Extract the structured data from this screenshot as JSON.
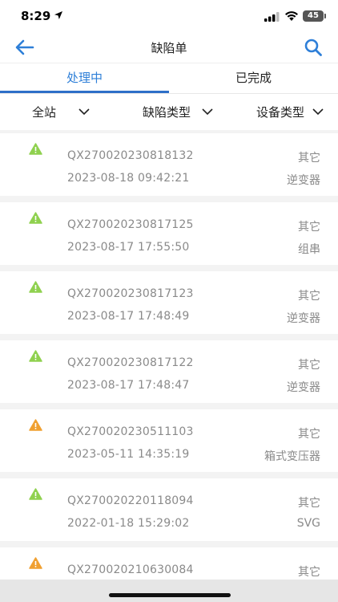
{
  "status_bar": {
    "time": "8:29",
    "battery": "45"
  },
  "nav": {
    "title": "缺陷单"
  },
  "tabs": [
    {
      "label": "处理中",
      "active": true
    },
    {
      "label": "已完成",
      "active": false
    }
  ],
  "filters": [
    {
      "label": "全站"
    },
    {
      "label": "缺陷类型"
    },
    {
      "label": "设备类型"
    }
  ],
  "colors": {
    "accent": "#2e7fd8",
    "warn_green": "#8fd14f",
    "warn_orange": "#f0a030"
  },
  "items": [
    {
      "code": "QX270020230818132",
      "time": "2023-08-18 09:42:21",
      "type": "其它",
      "device": "逆变器",
      "level": "green"
    },
    {
      "code": "QX270020230817125",
      "time": "2023-08-17 17:55:50",
      "type": "其它",
      "device": "组串",
      "level": "green"
    },
    {
      "code": "QX270020230817123",
      "time": "2023-08-17 17:48:49",
      "type": "其它",
      "device": "逆变器",
      "level": "green"
    },
    {
      "code": "QX270020230817122",
      "time": "2023-08-17 17:48:47",
      "type": "其它",
      "device": "逆变器",
      "level": "green"
    },
    {
      "code": "QX270020230511103",
      "time": "2023-05-11 14:35:19",
      "type": "其它",
      "device": "箱式变压器",
      "level": "orange"
    },
    {
      "code": "QX270020220118094",
      "time": "2022-01-18 15:29:02",
      "type": "其它",
      "device": "SVG",
      "level": "green"
    },
    {
      "code": "QX270020210630084",
      "time": "",
      "type": "其它",
      "device": "",
      "level": "orange"
    }
  ]
}
